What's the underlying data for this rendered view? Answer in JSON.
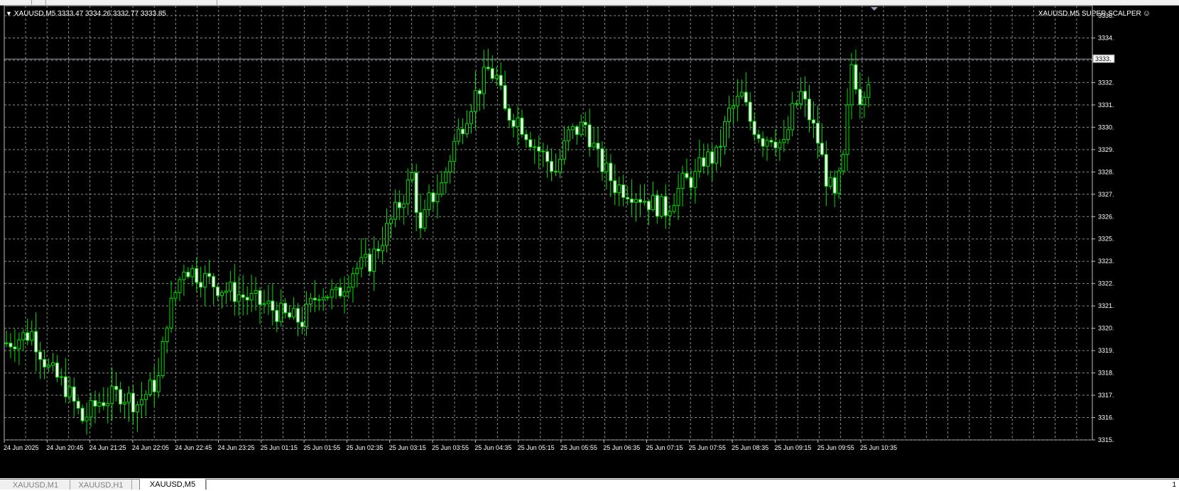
{
  "window": {
    "symbol_info": "XAUUSD,M5  3333.47 3334.26 3332.77 3333.85",
    "ea_label": "XAUUSD,M5 SUPER SCALPER",
    "ea_icon": "smiley-icon",
    "page_number": "1"
  },
  "tabs": [
    {
      "label": "XAUUSD,M1",
      "active": false
    },
    {
      "label": "XAUUSD,H1",
      "active": false
    },
    {
      "label": "XAUUSD,M5",
      "active": true
    }
  ],
  "colors": {
    "background": "#000000",
    "grid": "#8a8a8a",
    "candle": "#00e000",
    "bid_line": "#9aa0b0",
    "text": "#ffffff"
  },
  "chart_data": {
    "type": "candlestick",
    "symbol": "XAUUSD",
    "timeframe": "M5",
    "current_bid": 3333.85,
    "ylim": [
      3315,
      3336
    ],
    "y_ticks": [
      3336,
      3334,
      3333,
      3332,
      3331,
      3330,
      3329,
      3328,
      3327,
      3326,
      3325,
      3323,
      3322,
      3321,
      3320,
      3319,
      3318,
      3317,
      3316,
      3315
    ],
    "y_tick_labels": [
      "3336.",
      "3334.",
      "3333.",
      "3332.",
      "3331.",
      "3330.",
      "3329.",
      "3328.",
      "3327.",
      "3326.",
      "3325.",
      "3323.",
      "3322.",
      "3321.",
      "3320.",
      "3319.",
      "3318.",
      "3317.",
      "3316.",
      "3315."
    ],
    "x_tick_labels": [
      "24 Jun 2025",
      "24 Jun 20:45",
      "24 Jun 21:25",
      "24 Jun 22:05",
      "24 Jun 22:45",
      "24 Jun 23:25",
      "25 Jun 01:15",
      "25 Jun 01:55",
      "25 Jun 02:35",
      "25 Jun 03:15",
      "25 Jun 03:55",
      "25 Jun 04:35",
      "25 Jun 05:15",
      "25 Jun 05:55",
      "25 Jun 06:35",
      "25 Jun 07:15",
      "25 Jun 07:55",
      "25 Jun 08:35",
      "25 Jun 09:15",
      "25 Jun 09:55",
      "25 Jun 10:35"
    ],
    "close_path": [
      [
        0,
        3319.8
      ],
      [
        6,
        3320.3
      ],
      [
        10,
        3318.5
      ],
      [
        14,
        3317.6
      ],
      [
        18,
        3316.0
      ],
      [
        22,
        3316.9
      ],
      [
        27,
        3317.3
      ],
      [
        31,
        3316.8
      ],
      [
        36,
        3318.0
      ],
      [
        38,
        3321.0
      ],
      [
        42,
        3323.6
      ],
      [
        50,
        3322.6
      ],
      [
        56,
        3322.1
      ],
      [
        62,
        3321.6
      ],
      [
        66,
        3321.1
      ],
      [
        70,
        3320.9
      ],
      [
        74,
        3322.4
      ],
      [
        78,
        3322.1
      ],
      [
        82,
        3323.4
      ],
      [
        86,
        3323.8
      ],
      [
        90,
        3325.4
      ],
      [
        94,
        3327.1
      ],
      [
        96,
        3328.1
      ],
      [
        98,
        3325.2
      ],
      [
        100,
        3326.8
      ],
      [
        103,
        3327.6
      ],
      [
        106,
        3329.7
      ],
      [
        110,
        3331.7
      ],
      [
        114,
        3333.3
      ],
      [
        116,
        3332.9
      ],
      [
        118,
        3331.2
      ],
      [
        121,
        3330.9
      ],
      [
        125,
        3329.6
      ],
      [
        130,
        3328.3
      ],
      [
        133,
        3330.1
      ],
      [
        137,
        3330.6
      ],
      [
        140,
        3328.9
      ],
      [
        144,
        3327.6
      ],
      [
        148,
        3327.3
      ],
      [
        152,
        3326.8
      ],
      [
        156,
        3326.4
      ],
      [
        160,
        3327.7
      ],
      [
        163,
        3328.0
      ],
      [
        165,
        3328.9
      ],
      [
        168,
        3329.0
      ],
      [
        171,
        3331.2
      ],
      [
        174,
        3332.0
      ],
      [
        176,
        3330.8
      ],
      [
        179,
        3329.9
      ],
      [
        181,
        3330.1
      ],
      [
        184,
        3329.5
      ],
      [
        186,
        3331.2
      ],
      [
        188,
        3332.1
      ],
      [
        190,
        3331.0
      ],
      [
        192,
        3329.8
      ],
      [
        194,
        3328.0
      ],
      [
        196,
        3326.9
      ],
      [
        198,
        3328.8
      ],
      [
        200,
        3333.6
      ],
      [
        202,
        3332.0
      ],
      [
        204,
        3333.0
      ]
    ]
  }
}
